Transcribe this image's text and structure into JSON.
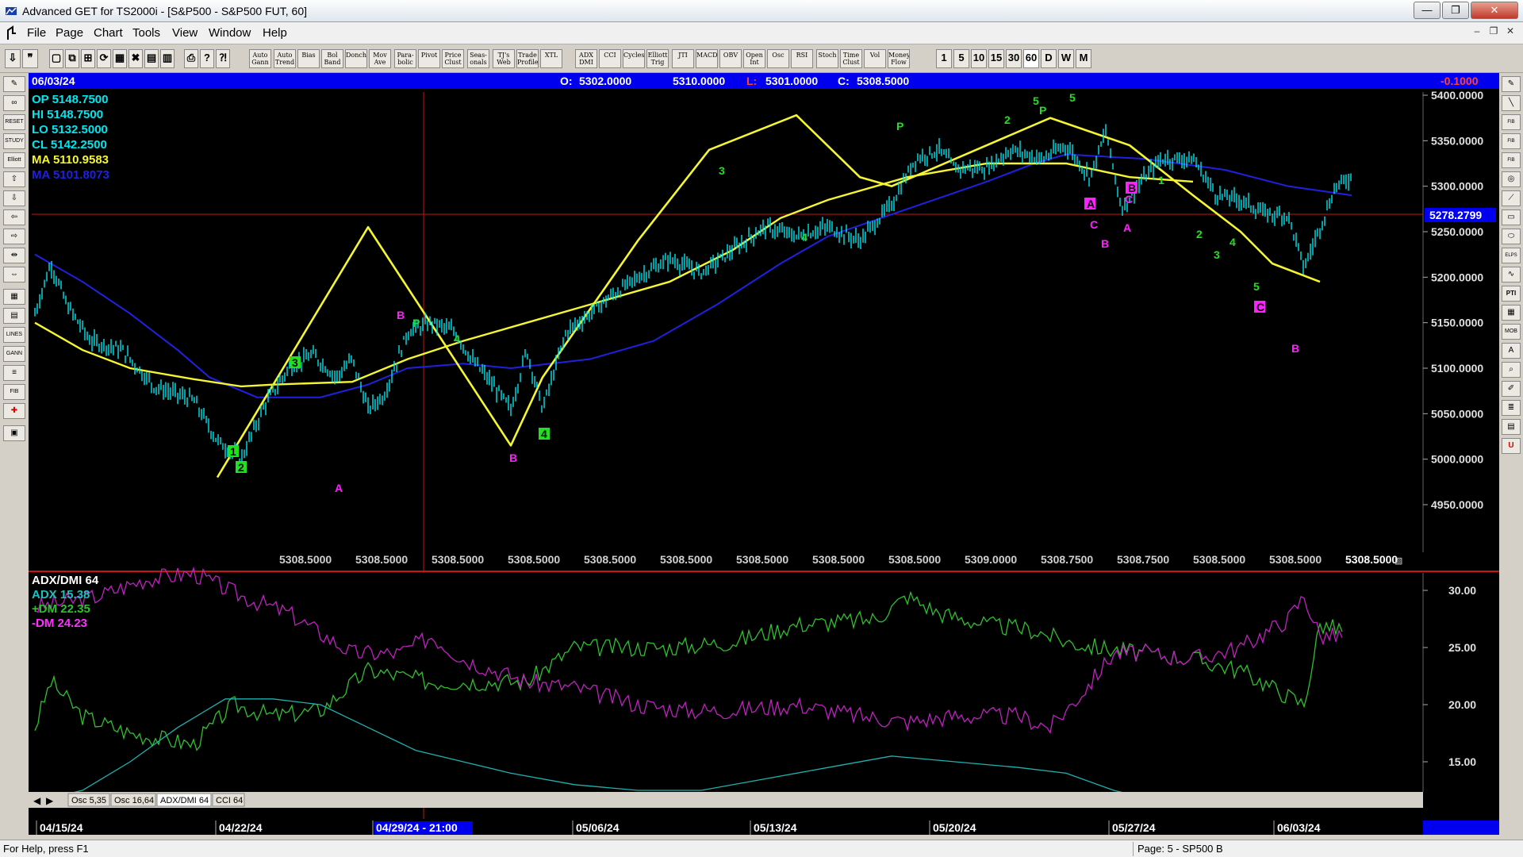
{
  "window": {
    "title": "Advanced GET for TS2000i - [S&P500 - S&P500 FUT, 60]",
    "minimize": "—",
    "maximize": "❐",
    "close": "✕"
  },
  "menu": {
    "items": [
      "File",
      "Page",
      "Chart",
      "Tools",
      "View",
      "Window",
      "Help"
    ]
  },
  "toolbar": {
    "study_buttons": [
      "Auto Gann",
      "Auto Trend",
      "Bias",
      "Bol Band",
      "Donch",
      "Mov Ave",
      "Para-bolic",
      "Pivot",
      "Price Clust",
      "Seas-onals",
      "TJ's Web",
      "Trade Profile",
      "XTL",
      "ADX DMI",
      "CCI",
      "Cycles",
      "Elliott Trig",
      "JTI",
      "MACD",
      "OBV",
      "Open Int",
      "Osc",
      "RSI",
      "Stoch",
      "Time Clust",
      "Vol",
      "Money Flow"
    ],
    "interval_buttons": [
      "1",
      "5",
      "10",
      "15",
      "30",
      "60",
      "D",
      "W",
      "M"
    ],
    "active_interval": "60"
  },
  "chart_header": {
    "date": "06/03/24",
    "open_label": "O:",
    "open": "5302.0000",
    "high": "5310.0000",
    "low_label": "L:",
    "low": "5301.0000",
    "close_label": "C:",
    "close": "5308.5000",
    "change": "-0.1000"
  },
  "price_info": {
    "op": "OP  5148.7500",
    "hi": "HI   5148.7500",
    "lo": "LO  5132.5000",
    "cl": "CL   5142.2500",
    "ma1": "MA  5110.9583",
    "ma2": "MA  5101.8073"
  },
  "price_axis": {
    "labels": [
      "5400.0000",
      "5350.0000",
      "5300.0000",
      "5250.0000",
      "5200.0000",
      "5150.0000",
      "5100.0000",
      "5050.0000",
      "5000.0000",
      "4950.0000"
    ],
    "crosshair_value": "5278.2799"
  },
  "bottom_readouts": [
    "5308.5000",
    "5308.5000",
    "5308.5000",
    "5308.5000",
    "5308.5000",
    "5308.5000",
    "5308.5000",
    "5308.5000",
    "5308.5000",
    "5309.0000",
    "5308.7500",
    "5308.7500",
    "5308.5000",
    "5308.5000",
    "5308.5000"
  ],
  "wave_labels": {
    "green": [
      "1",
      "2",
      "3",
      "4",
      "5",
      "P",
      "P",
      "2",
      "4",
      "3",
      "4",
      "1",
      "2",
      "3",
      "4",
      "5",
      "5",
      "P"
    ],
    "magenta": [
      "B",
      "A",
      "B",
      "A",
      "B",
      "A",
      "C",
      "B",
      "C",
      "C",
      "B"
    ]
  },
  "indicator": {
    "title": "ADX/DMI 64",
    "adx": "ADX 15.38",
    "plus_dm": "+DM 22.35",
    "minus_dm": "-DM  24.23",
    "axis_labels": [
      "30.00",
      "25.00",
      "20.00",
      "15.00"
    ]
  },
  "indicator_tabs": [
    "Osc 5,35",
    "Osc 16,64",
    "ADX/DMI 64",
    "CCI 64"
  ],
  "active_tab": "ADX/DMI 64",
  "date_axis": {
    "labels": [
      "04/15/24",
      "04/22/24",
      "04/29/24 - 21:00",
      "05/06/24",
      "05/13/24",
      "05/20/24",
      "05/27/24",
      "06/03/24"
    ]
  },
  "status": {
    "help": "For Help, press F1",
    "page": "Page: 5 - SP500 B"
  },
  "colors": {
    "price_bars": "#00e5ee",
    "ma_yellow": "#f5f532",
    "ma_blue": "#2020e0",
    "plus_dm": "#2ec02e",
    "minus_dm": "#c020c0",
    "adx": "#20b0b0",
    "header_bar": "#0000ee",
    "wave_green": "#20e020",
    "wave_magenta": "#ff20ff"
  }
}
